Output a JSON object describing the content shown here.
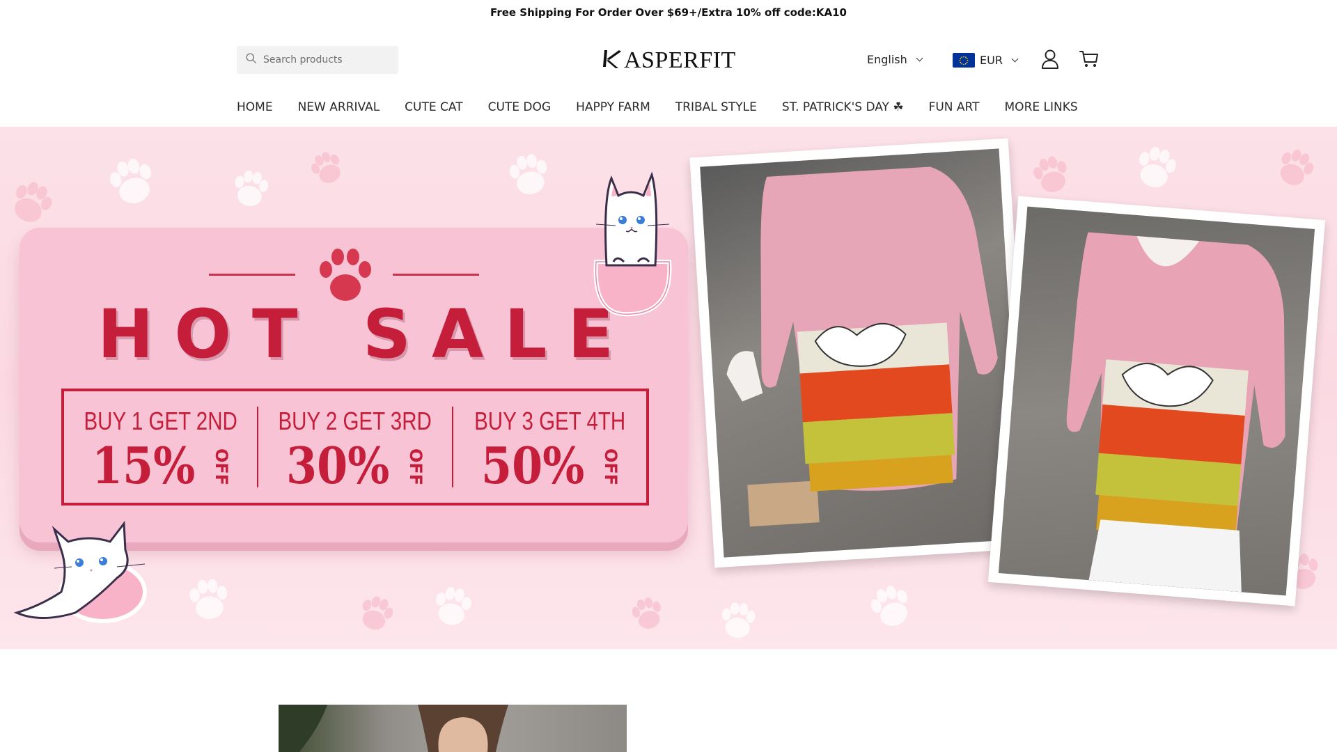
{
  "announcement": "Free Shipping For Order Over $69+/Extra 10% off code:KA10",
  "header": {
    "search_placeholder": "Search products",
    "logo_text": "ASPERFIT",
    "logo_letter": "K",
    "language": "English",
    "currency": "EUR",
    "icons": [
      "search-icon",
      "account-icon",
      "cart-icon",
      "eu-flag-icon",
      "chevron-down-icon"
    ]
  },
  "nav": {
    "items": [
      {
        "label": "HOME"
      },
      {
        "label": "NEW ARRIVAL"
      },
      {
        "label": "CUTE CAT"
      },
      {
        "label": "CUTE DOG"
      },
      {
        "label": "HAPPY FARM"
      },
      {
        "label": "TRIBAL STYLE"
      },
      {
        "label": "ST. PATRICK'S DAY ☘"
      },
      {
        "label": "FUN ART"
      },
      {
        "label": "MORE LINKS"
      }
    ]
  },
  "hero": {
    "title": "HOT SALE",
    "offers": [
      {
        "head": "BUY 1 GET 2ND",
        "percent": "15%",
        "off": "OFF"
      },
      {
        "head": "BUY 2 GET 3RD",
        "percent": "30%",
        "off": "OFF"
      },
      {
        "head": "BUY 3 GET 4TH",
        "percent": "50%",
        "off": "OFF"
      }
    ],
    "colors": {
      "background": "#fce1e8",
      "card": "#f9c3d6",
      "accent_red": "#c41e3a"
    }
  }
}
